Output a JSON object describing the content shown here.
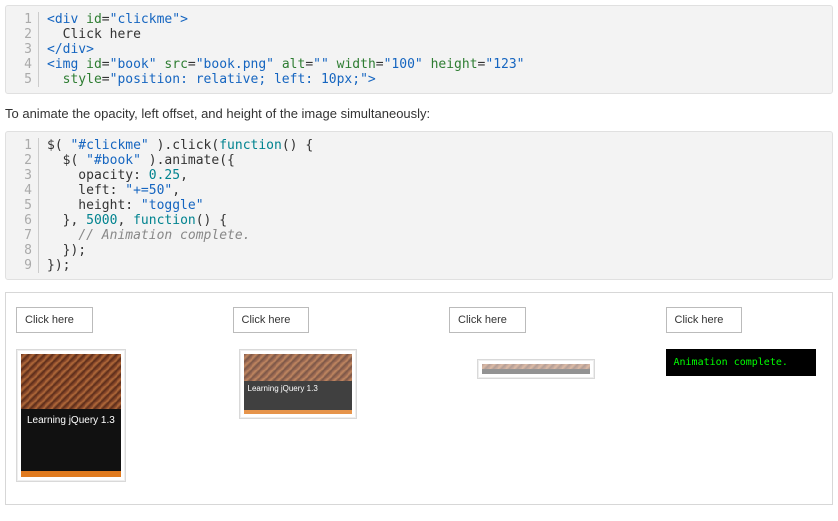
{
  "code1": {
    "lines": [
      {
        "n": "1",
        "html": "<span class='c-blue'>&lt;div</span> <span class='c-green'>id</span>=<span class='c-blue'>\"clickme\"</span><span class='c-blue'>&gt;</span>"
      },
      {
        "n": "2",
        "html": "  Click here"
      },
      {
        "n": "3",
        "html": "<span class='c-blue'>&lt;/div&gt;</span>"
      },
      {
        "n": "4",
        "html": "<span class='c-blue'>&lt;img</span> <span class='c-green'>id</span>=<span class='c-blue'>\"book\"</span> <span class='c-green'>src</span>=<span class='c-blue'>\"book.png\"</span> <span class='c-green'>alt</span>=<span class='c-blue'>\"\"</span> <span class='c-green'>width</span>=<span class='c-blue'>\"100\"</span> <span class='c-green'>height</span>=<span class='c-blue'>\"123\"</span>"
      },
      {
        "n": "5",
        "html": "  <span class='c-green'>style</span>=<span class='c-blue'>\"position: relative; left: 10px;\"</span><span class='c-blue'>&gt;</span>"
      }
    ]
  },
  "prose1": "To animate the opacity, left offset, and height of the image simultaneously:",
  "code2": {
    "lines": [
      {
        "n": "1",
        "html": "$( <span class='c-blue'>\"#clickme\"</span> ).click(<span class='c-teal'>function</span>() {"
      },
      {
        "n": "2",
        "html": "  $( <span class='c-blue'>\"#book\"</span> ).animate({"
      },
      {
        "n": "3",
        "html": "    opacity: <span class='c-teal'>0.25</span>,"
      },
      {
        "n": "4",
        "html": "    left: <span class='c-blue'>\"+=50\"</span>,"
      },
      {
        "n": "5",
        "html": "    height: <span class='c-blue'>\"toggle\"</span>"
      },
      {
        "n": "6",
        "html": "  }, <span class='c-teal'>5000</span>, <span class='c-teal'>function</span>() {"
      },
      {
        "n": "7",
        "html": "    <span class='c-gray'>// Animation complete.</span>"
      },
      {
        "n": "8",
        "html": "  });"
      },
      {
        "n": "9",
        "html": "});"
      }
    ]
  },
  "demo": {
    "click_label": "Click here",
    "book_title": "Learning jQuery 1.3",
    "done_text": "Animation complete."
  }
}
